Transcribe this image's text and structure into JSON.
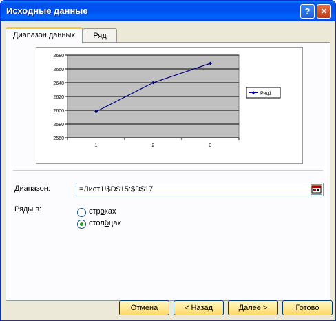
{
  "window": {
    "title": "Исходные данные",
    "help_label": "?",
    "close_label": "×"
  },
  "tabs": [
    {
      "label": "Диапазон данных"
    },
    {
      "label": "Ряд"
    }
  ],
  "chart_data": {
    "type": "line",
    "x": [
      1,
      2,
      3
    ],
    "series": [
      {
        "name": "Ряд1",
        "values": [
          2598,
          2640,
          2668
        ]
      }
    ],
    "ylim": [
      2560,
      2680
    ],
    "yticks": [
      2560,
      2580,
      2600,
      2620,
      2640,
      2660,
      2680
    ],
    "xticks": [
      1,
      2,
      3
    ],
    "grid": true,
    "legend": "right",
    "colors": {
      "plot_bg": "#c0c0c0",
      "line": "#000080"
    }
  },
  "form": {
    "range_label": "Диапазон:",
    "range_value": "=Лист1!$D$15:$D$17",
    "series_in_label": "Ряды в:",
    "options": [
      {
        "pre": "стр",
        "accel": "о",
        "post": "ках",
        "selected": false
      },
      {
        "pre": "стол",
        "accel": "б",
        "post": "цах",
        "selected": true
      }
    ]
  },
  "buttons": {
    "cancel": {
      "pre": "",
      "accel": "",
      "post": "Отмена"
    },
    "back": {
      "pre": "< ",
      "accel": "Н",
      "post": "азад"
    },
    "next": {
      "pre": "",
      "accel": "Д",
      "post": "алее >"
    },
    "finish": {
      "pre": "",
      "accel": "Г",
      "post": "отово"
    }
  }
}
